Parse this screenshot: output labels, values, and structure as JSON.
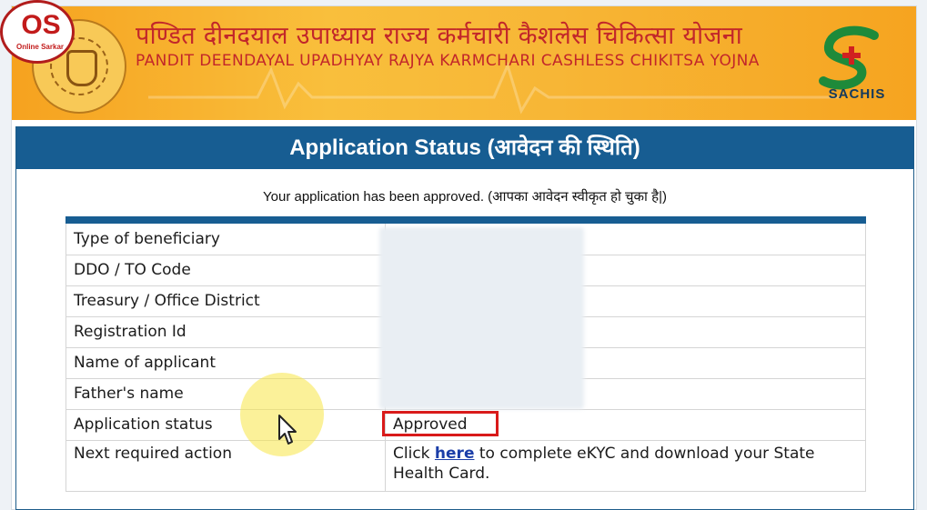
{
  "header": {
    "title_hindi": "पण्डित दीनदयाल उपाध्याय राज्य कर्मचारी कैशलेस चिकित्सा योजना",
    "title_english": "PANDIT DEENDAYAL UPADHYAY RAJYA KARMCHARI CASHLESS CHIKITSA YOJNA",
    "logo_text": "SACHIS"
  },
  "watermark": {
    "text": "OS",
    "subtext": "Online Sarkar"
  },
  "status_panel": {
    "title": "Application Status (आवेदन की स्थिति)",
    "message": "Your application has been approved. (आपका आवेदन स्वीकृत हो चुका है|)"
  },
  "table": {
    "rows": [
      {
        "label": "Type of beneficiary",
        "value": ""
      },
      {
        "label": "DDO / TO Code",
        "value": ""
      },
      {
        "label": "Treasury / Office District",
        "value": ""
      },
      {
        "label": "Registration Id",
        "value": ""
      },
      {
        "label": "Name of applicant",
        "value": ""
      },
      {
        "label": "Father's name",
        "value": ""
      },
      {
        "label": "Application status",
        "value": "Approved"
      },
      {
        "label": "Next required action",
        "value": ""
      }
    ],
    "next_action": {
      "prefix": "Click",
      "link_text": "here",
      "suffix": "to complete eKYC and download your State Health Card."
    }
  }
}
